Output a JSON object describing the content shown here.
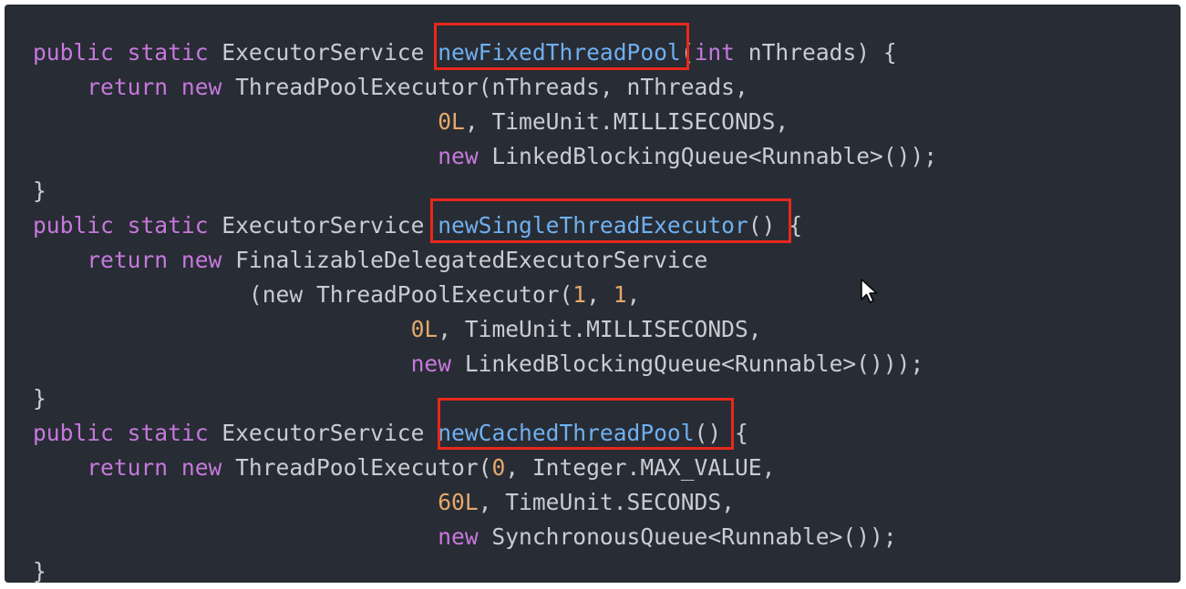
{
  "code": {
    "lines": [
      [
        {
          "t": "kw",
          "s": "public"
        },
        {
          "t": "p",
          "s": " "
        },
        {
          "t": "kw",
          "s": "static"
        },
        {
          "t": "p",
          "s": " ExecutorService "
        },
        {
          "t": "fn",
          "s": "newFixedThreadPool"
        },
        {
          "t": "p",
          "s": "("
        },
        {
          "t": "kw",
          "s": "int"
        },
        {
          "t": "p",
          "s": " nThreads) {"
        }
      ],
      [
        {
          "t": "p",
          "s": "    "
        },
        {
          "t": "kw",
          "s": "return"
        },
        {
          "t": "p",
          "s": " "
        },
        {
          "t": "kw",
          "s": "new"
        },
        {
          "t": "p",
          "s": " ThreadPoolExecutor(nThreads, nThreads,"
        }
      ],
      [
        {
          "t": "p",
          "s": "                              "
        },
        {
          "t": "num",
          "s": "0L"
        },
        {
          "t": "p",
          "s": ", TimeUnit.MILLISECONDS,"
        }
      ],
      [
        {
          "t": "p",
          "s": "                              "
        },
        {
          "t": "kw",
          "s": "new"
        },
        {
          "t": "p",
          "s": " LinkedBlockingQueue<Runnable>());"
        }
      ],
      [
        {
          "t": "p",
          "s": "}"
        }
      ],
      [
        {
          "t": "kw",
          "s": "public"
        },
        {
          "t": "p",
          "s": " "
        },
        {
          "t": "kw",
          "s": "static"
        },
        {
          "t": "p",
          "s": " ExecutorService "
        },
        {
          "t": "fn",
          "s": "newSingleThreadExecutor"
        },
        {
          "t": "p",
          "s": "() {"
        }
      ],
      [
        {
          "t": "p",
          "s": "    "
        },
        {
          "t": "kw",
          "s": "return"
        },
        {
          "t": "p",
          "s": " "
        },
        {
          "t": "kw",
          "s": "new"
        },
        {
          "t": "p",
          "s": " FinalizableDelegatedExecutorService"
        }
      ],
      [
        {
          "t": "p",
          "s": "                (new ThreadPoolExecutor("
        },
        {
          "t": "num",
          "s": "1"
        },
        {
          "t": "p",
          "s": ", "
        },
        {
          "t": "num",
          "s": "1"
        },
        {
          "t": "p",
          "s": ","
        }
      ],
      [
        {
          "t": "p",
          "s": "                            "
        },
        {
          "t": "num",
          "s": "0L"
        },
        {
          "t": "p",
          "s": ", TimeUnit.MILLISECONDS,"
        }
      ],
      [
        {
          "t": "p",
          "s": "                            "
        },
        {
          "t": "kw",
          "s": "new"
        },
        {
          "t": "p",
          "s": " LinkedBlockingQueue<Runnable>()));"
        }
      ],
      [
        {
          "t": "p",
          "s": "}"
        }
      ],
      [
        {
          "t": "kw",
          "s": "public"
        },
        {
          "t": "p",
          "s": " "
        },
        {
          "t": "kw",
          "s": "static"
        },
        {
          "t": "p",
          "s": " ExecutorService "
        },
        {
          "t": "fn",
          "s": "newCachedThreadPool"
        },
        {
          "t": "p",
          "s": "() {"
        }
      ],
      [
        {
          "t": "p",
          "s": "    "
        },
        {
          "t": "kw",
          "s": "return"
        },
        {
          "t": "p",
          "s": " "
        },
        {
          "t": "kw",
          "s": "new"
        },
        {
          "t": "p",
          "s": " ThreadPoolExecutor("
        },
        {
          "t": "num",
          "s": "0"
        },
        {
          "t": "p",
          "s": ", Integer.MAX_VALUE,"
        }
      ],
      [
        {
          "t": "p",
          "s": "                              "
        },
        {
          "t": "num",
          "s": "60L"
        },
        {
          "t": "p",
          "s": ", TimeUnit.SECONDS,"
        }
      ],
      [
        {
          "t": "p",
          "s": "                              "
        },
        {
          "t": "kw",
          "s": "new"
        },
        {
          "t": "p",
          "s": " SynchronousQueue<Runnable>());"
        }
      ],
      [
        {
          "t": "p",
          "s": "}"
        }
      ]
    ]
  },
  "colors": {
    "panel_background": "#282c34",
    "keyword": "#c678dd",
    "number": "#e5a96b",
    "function_name": "#6fb0f0",
    "plain_text": "#c9ccd2",
    "highlight_border": "#e8281c"
  },
  "highlights": [
    "newFixedThreadPool",
    "newSingleThreadExecutor",
    "newCachedThreadPool"
  ],
  "cursor": {
    "icon": "mouse-pointer-icon"
  }
}
